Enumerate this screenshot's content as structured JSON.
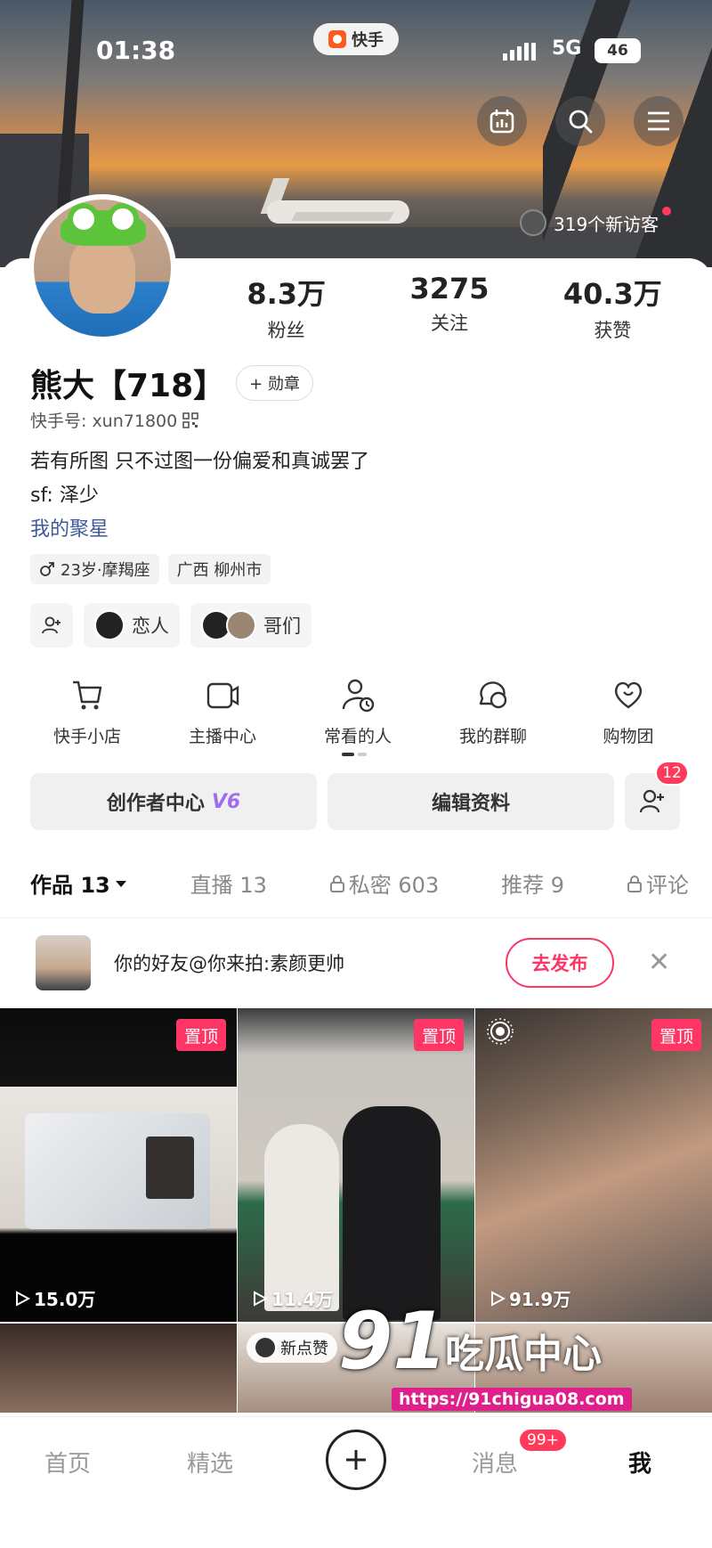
{
  "status_bar": {
    "time": "01:38",
    "app_pill": "快手",
    "network": "5G",
    "battery": "46"
  },
  "header": {
    "visitors": "319个新访客"
  },
  "stats": [
    {
      "value": "8.3万",
      "label": "粉丝"
    },
    {
      "value": "3275",
      "label": "关注"
    },
    {
      "value": "40.3万",
      "label": "获赞"
    }
  ],
  "profile": {
    "name": "熊大【718】",
    "badge_button": "+ 勋章",
    "kuaishou_id": "快手号: xun71800",
    "bio_line1": "若有所图 只不过图一份偏爱和真诚罢了",
    "bio_line2": "sf: 泽少",
    "bio_link": "我的聚星"
  },
  "tags": {
    "age": "23岁·摩羯座",
    "location": "广西 柳州市"
  },
  "relations": {
    "lover": "恋人",
    "brothers": "哥们"
  },
  "shortcuts": [
    {
      "label": "快手小店",
      "icon": "cart-icon"
    },
    {
      "label": "主播中心",
      "icon": "camera-icon"
    },
    {
      "label": "常看的人",
      "icon": "person-clock-icon"
    },
    {
      "label": "我的群聊",
      "icon": "chat-group-icon"
    },
    {
      "label": "购物团",
      "icon": "heart-bag-icon"
    }
  ],
  "actions": {
    "creator": "创作者中心",
    "creator_level": "V6",
    "edit": "编辑资料",
    "friend_requests": "12"
  },
  "tabs": {
    "works": "作品 13",
    "live": "直播 13",
    "private": "私密 603",
    "recommend": "推荐 9",
    "comments": "评论"
  },
  "invite": {
    "text": "你的好友@你来拍:素颜更帅",
    "button": "去发布"
  },
  "grid": [
    {
      "pin": "置顶",
      "views": "15.0万"
    },
    {
      "pin": "置顶",
      "views": "11.4万"
    },
    {
      "pin": "置顶",
      "views": "91.9万"
    }
  ],
  "grid_new_badge": "新点赞",
  "watermark": {
    "big": "91",
    "side": "吃瓜中心",
    "url": "https://91chigua08.com"
  },
  "bottom_nav": {
    "home": "首页",
    "featured": "精选",
    "messages": "消息",
    "messages_count": "99+",
    "me": "我"
  },
  "colors": {
    "accent": "#fe3666",
    "link": "#3e5a9a",
    "vip": "#a06cf0",
    "badge": "#ff3a5a"
  }
}
